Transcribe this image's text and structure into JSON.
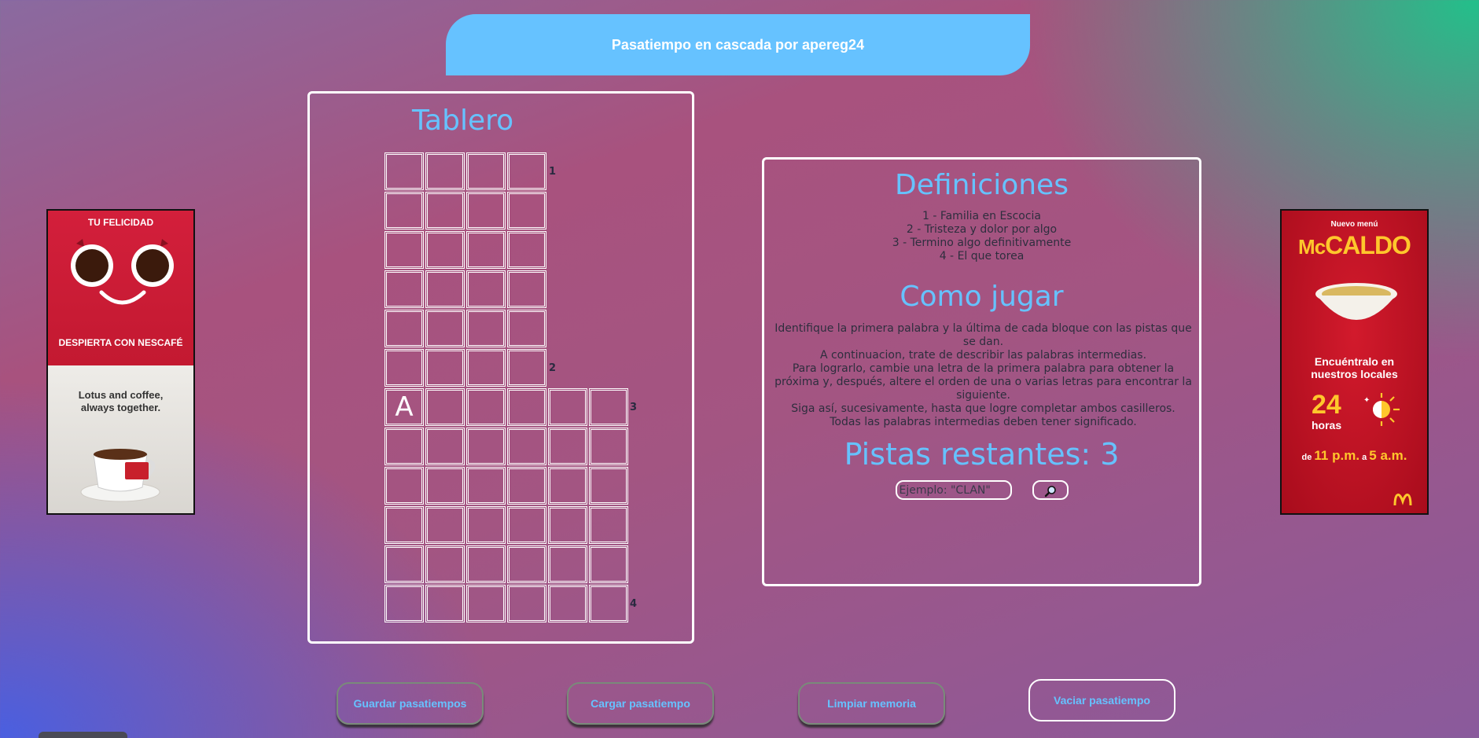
{
  "header": {
    "title": "Pasatiempo en cascada por apereg24"
  },
  "board": {
    "title": "Tablero",
    "filled_letter": "A",
    "row_numbers": [
      "1",
      "2",
      "3",
      "4"
    ]
  },
  "definitions": {
    "title": "Definiciones",
    "items": [
      "1 - Familia en Escocia",
      "2 - Tristeza y dolor por algo",
      "3 - Termino algo definitivamente",
      "4 - El que torea"
    ]
  },
  "how_to_play": {
    "title": "Como jugar",
    "lines": [
      "Identifique la primera palabra y la última de cada bloque con las pistas que se dan.",
      "A continuacion, trate de describir las palabras intermedias.",
      "Para lograrlo, cambie una letra de la primera palabra para obtener la próxima y, después, altere el orden de una o varias letras para encontrar la siguiente.",
      "Siga así, sucesivamente, hasta que logre completar ambos casilleros.",
      "Todas las palabras intermedias deben tener significado."
    ]
  },
  "hints": {
    "label": "Pistas restantes: 3",
    "input_placeholder": "Ejemplo: \"CLAN\"",
    "search_icon": "magnifier-icon"
  },
  "ads": {
    "left": {
      "headline": "TU FELICIDAD",
      "tagline": "DESPIERTA CON NESCAFÉ",
      "line1": "Lotus and coffee,",
      "line2": "always together."
    },
    "right": {
      "menu": "Nuevo menú",
      "brand_mc": "Mc",
      "brand_caldo": "CALDO",
      "find1": "Encuéntralo en",
      "find2": "nuestros locales",
      "hours_num": "24",
      "hours_word": "horas",
      "time_de": "de",
      "time_start": "11 p.m.",
      "time_a": "a",
      "time_end": "5 a.m."
    }
  },
  "buttons": {
    "save": "Guardar pasatiempos",
    "load": "Cargar pasatiempo",
    "clear_memory": "Limpiar memoria",
    "empty": "Vaciar pasatiempo"
  },
  "colors": {
    "accent": "#66c2ff",
    "header_bg": "#66c2ff"
  }
}
